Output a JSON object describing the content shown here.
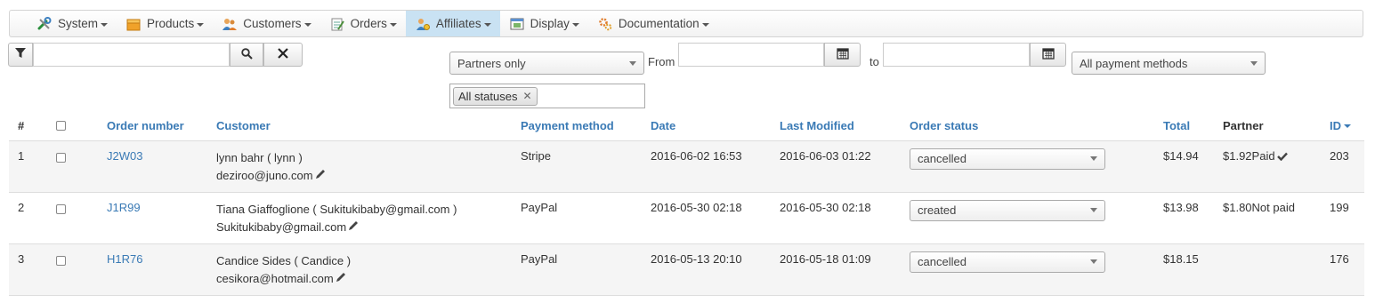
{
  "menu": [
    {
      "label": "System",
      "icon": "tools-icon"
    },
    {
      "label": "Products",
      "icon": "box-icon"
    },
    {
      "label": "Customers",
      "icon": "users-icon"
    },
    {
      "label": "Orders",
      "icon": "clipboard-icon"
    },
    {
      "label": "Affiliates",
      "icon": "affiliate-icon",
      "active": true
    },
    {
      "label": "Display",
      "icon": "display-icon"
    },
    {
      "label": "Documentation",
      "icon": "gears-icon"
    }
  ],
  "filters": {
    "search_value": "",
    "partners_select": "Partners only",
    "from_label": "From",
    "from_value": "",
    "to_label": "to",
    "to_value": "",
    "payment_select": "All payment methods",
    "status_tag": "All statuses"
  },
  "table": {
    "headers": {
      "num": "#",
      "order_number": "Order number",
      "customer": "Customer",
      "payment_method": "Payment method",
      "date": "Date",
      "last_modified": "Last Modified",
      "order_status": "Order status",
      "total": "Total",
      "partner": "Partner",
      "id": "ID"
    },
    "rows": [
      {
        "num": "1",
        "order_number": "J2W03",
        "customer_name": "lynn bahr ( lynn )",
        "customer_email": "deziroo@juno.com",
        "payment_method": "Stripe",
        "date": "2016-06-02 16:53",
        "last_modified": "2016-06-03 01:22",
        "status": "cancelled",
        "total": "$14.94",
        "partner_amount": "$1.92",
        "partner_status": "Paid",
        "paid_check": true,
        "id": "203"
      },
      {
        "num": "2",
        "order_number": "J1R99",
        "customer_name": "Tiana Giaffoglione ( Sukitukibaby@gmail.com )",
        "customer_email": "Sukitukibaby@gmail.com",
        "payment_method": "PayPal",
        "date": "2016-05-30 02:18",
        "last_modified": "2016-05-30 02:18",
        "status": "created",
        "total": "$13.98",
        "partner_amount": "$1.80",
        "partner_status": "Not paid",
        "paid_check": false,
        "id": "199"
      },
      {
        "num": "3",
        "order_number": "H1R76",
        "customer_name": "Candice Sides ( Candice )",
        "customer_email": "cesikora@hotmail.com",
        "payment_method": "PayPal",
        "date": "2016-05-13 20:10",
        "last_modified": "2016-05-18 01:09",
        "status": "cancelled",
        "total": "$18.15",
        "partner_amount": "",
        "partner_status": "",
        "paid_check": false,
        "id": "176"
      }
    ]
  }
}
